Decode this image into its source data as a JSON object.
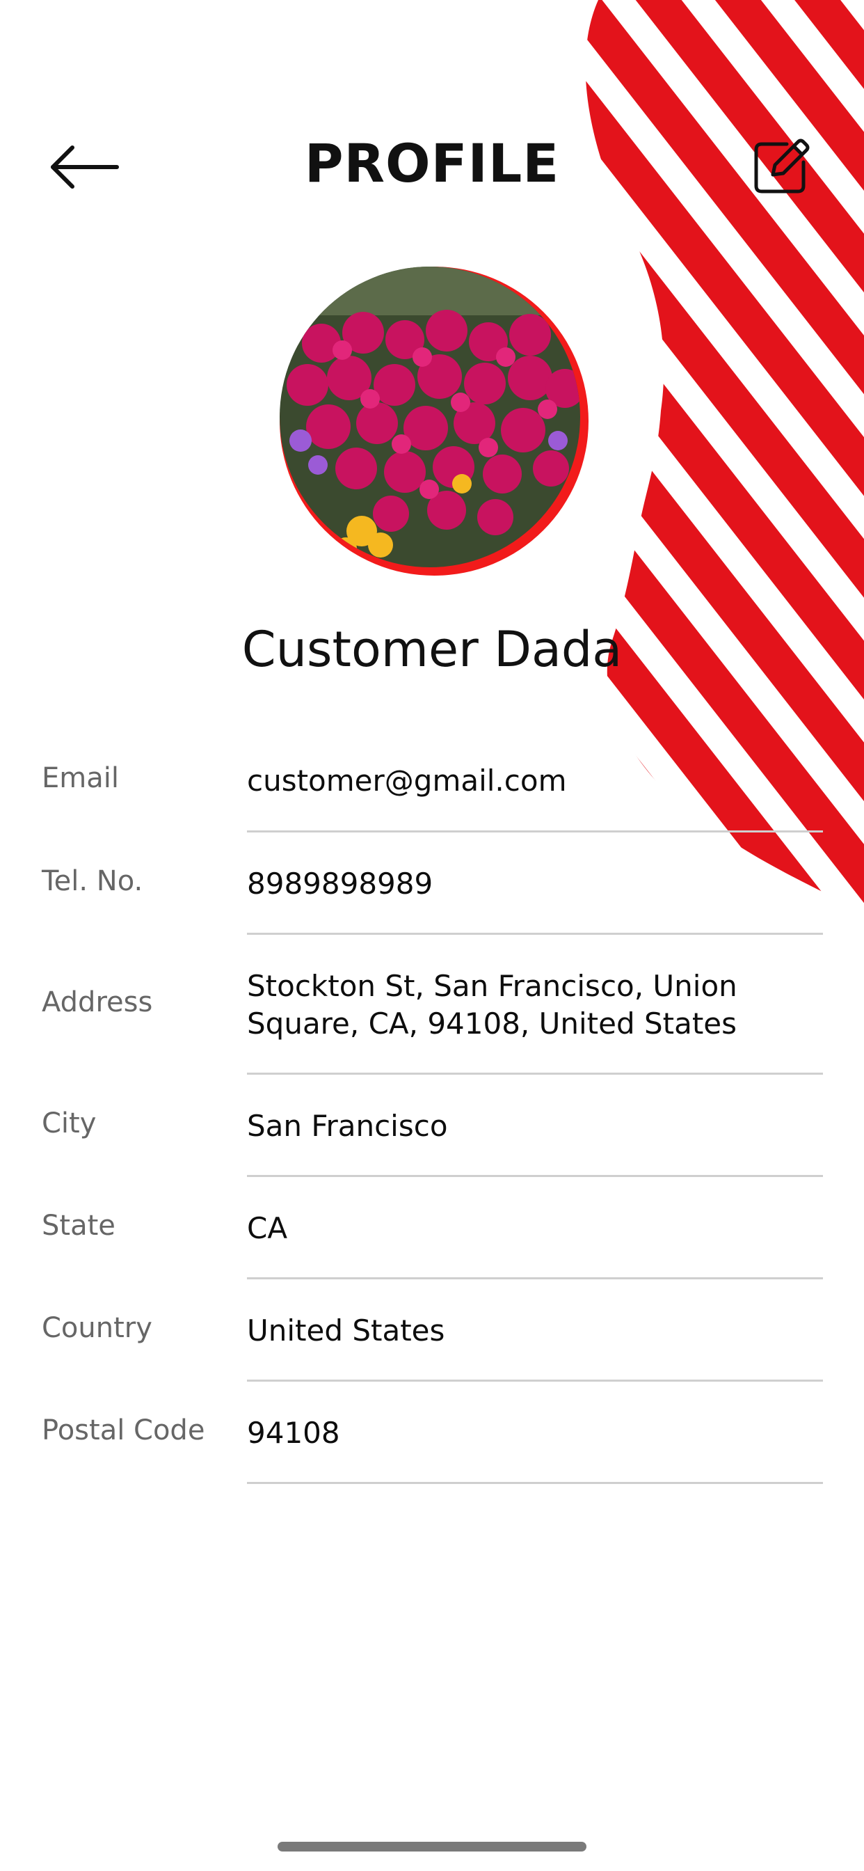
{
  "header": {
    "title": "PROFILE",
    "back_icon": "arrow-left-icon",
    "edit_icon": "edit-square-icon"
  },
  "profile": {
    "name": "Customer Dada",
    "avatar_description": "pink flowers photo"
  },
  "fields": [
    {
      "label": "Email",
      "value": "customer@gmail.com"
    },
    {
      "label": "Tel. No.",
      "value": "8989898989"
    },
    {
      "label": "Address",
      "value": "Stockton St, San Francisco, Union Square, CA, 94108, United States"
    },
    {
      "label": "City",
      "value": "San Francisco"
    },
    {
      "label": "State",
      "value": "CA"
    },
    {
      "label": "Country",
      "value": "United States"
    },
    {
      "label": "Postal Code",
      "value": "94108"
    }
  ],
  "colors": {
    "accent": "#e3131b",
    "label": "#666666",
    "divider": "#cfcfcf"
  }
}
